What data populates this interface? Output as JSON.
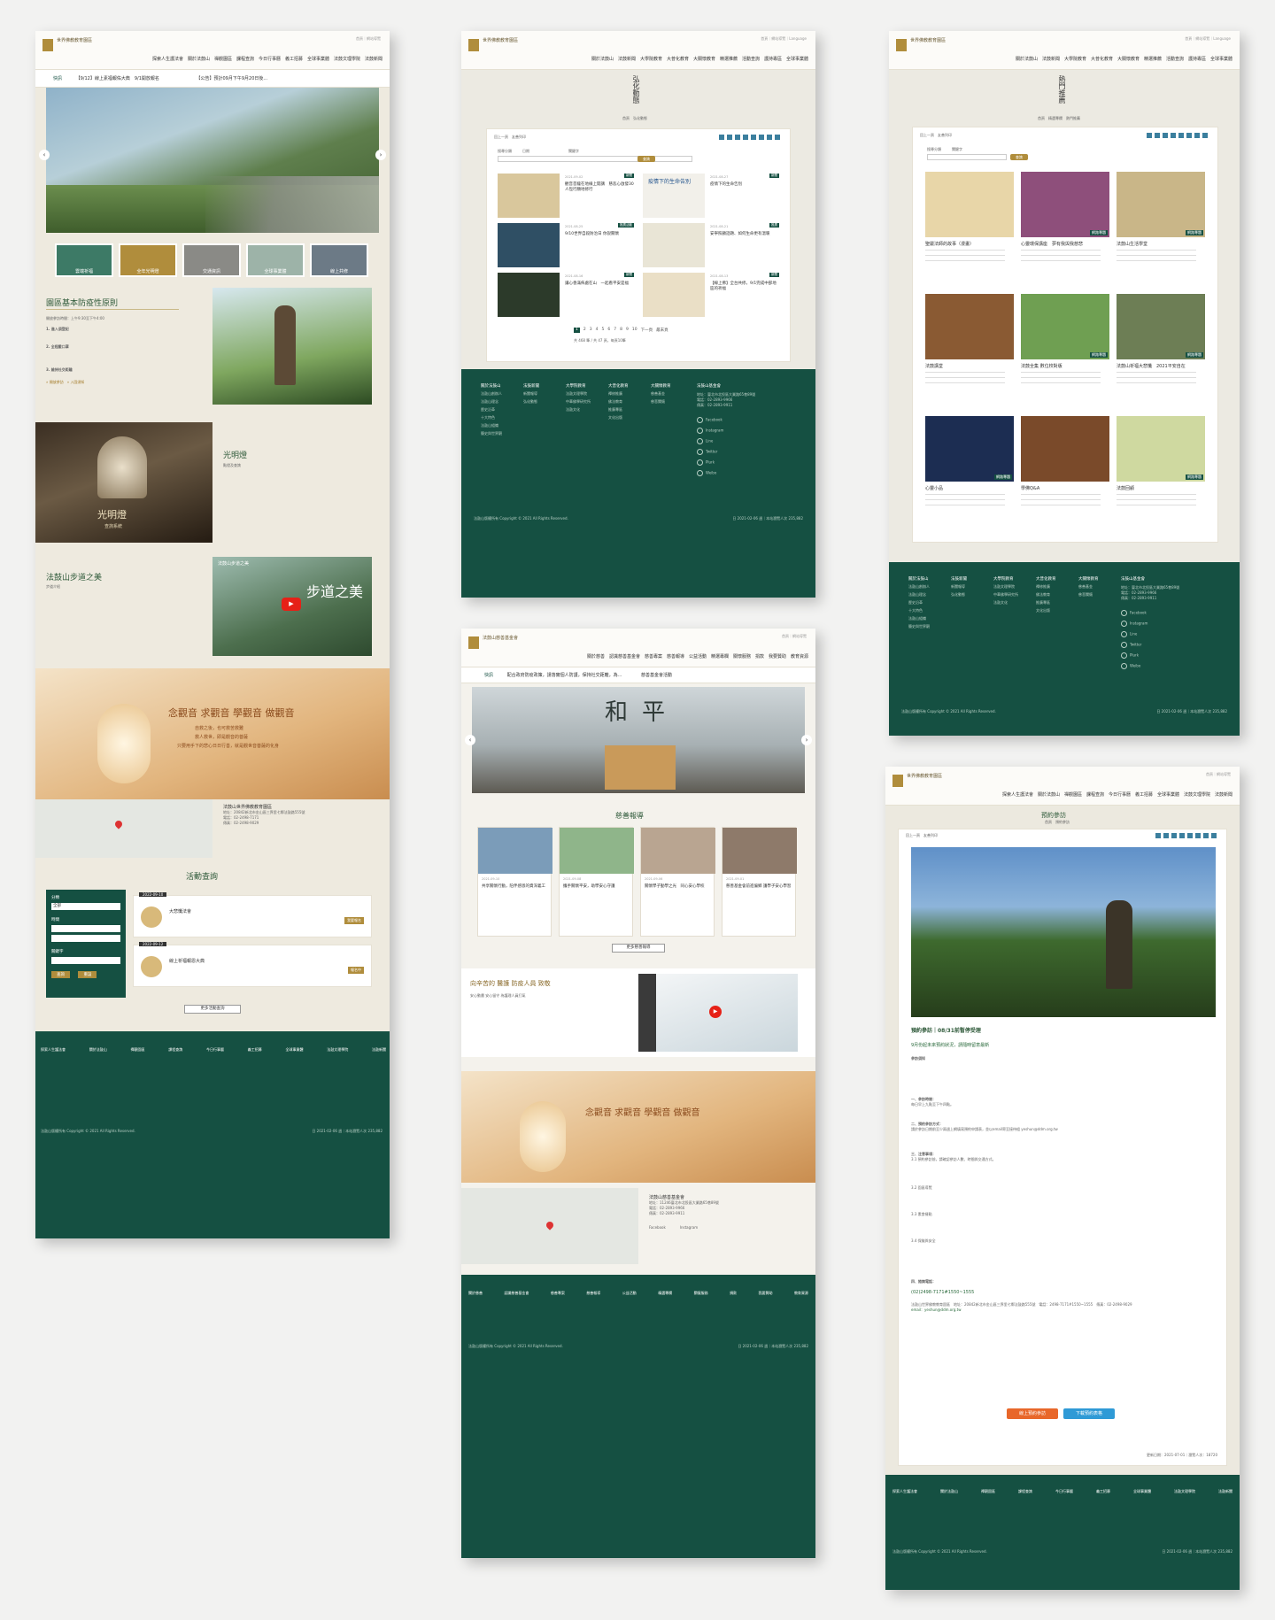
{
  "brand": {
    "name": "法鼓山",
    "org": "世界佛教教育園區",
    "accent": "#155042",
    "gold": "#b08d3c"
  },
  "nav": {
    "p1": "探索人生護法會　關於法鼓山　禪觀園區　課程查詢　今日行事曆　義工招募　全球事業體　法鼓文理學院　法鼓新聞",
    "p2": "關於法鼓山　法鼓新聞　大學院教育　大普化教育　大關懷教育　精選推薦　活動查詢　護持專區　全球事業體",
    "p4": "關於慈善　認識慈善基金會　慈善專案　慈善報導　公益活動　精選專欄　關懷服務　捐款　我要贊助　教育資源"
  },
  "util": {
    "login": "首頁",
    "sitemap": "網站導覽",
    "language": "Language"
  },
  "p1": {
    "ticker_label": "快訊",
    "ticker_1": "【9/12】線上素福報佑大典　9/1開放報名",
    "ticker_2": "【公告】預計09月下午9月20日後...",
    "quick_links": [
      "雲端祈福",
      "全年光明燈",
      "交通資訊",
      "全球事業體",
      "線上共修"
    ],
    "epidemic_title": "園區基本防疫性原則",
    "epidemic_hours": "開放參訪時間：上午9:30至下午4:00",
    "epidemic_1": "1. 進入須登記",
    "epidemic_2": "2. 全程戴口罩",
    "epidemic_3": "3. 維持社交距離",
    "epidemic_link1": "» 開放參訪",
    "epidemic_link2": "» 入園須知",
    "lamp_title": "光明燈",
    "lamp_sub": "點燈及查詢",
    "lamp_img_text": "光明燈",
    "lamp_img_sub": "查詢系統",
    "trail_title": "法鼓山步道之美",
    "trail_sub": "步道介紹",
    "video_title": "法鼓山步道之美",
    "video_word": "步道之美",
    "banner_title": "念觀音 求觀音 學觀音 做觀音",
    "banner_sub1": "自救之後，也可救苦救難",
    "banner_sub2": "救人救世，即是觀音的菩薩",
    "banner_sub3": "只要用手下的悲心日日行善，就是觀世音菩薩的化身",
    "map_name": "法鼓山世界佛教教育園區",
    "addr": "地址：20842新北市金山區三界里七鄰法鼓路555號",
    "tel": "電話：02-2498-7171",
    "fax": "傳真：02-2498-9029",
    "activity_title": "活動查詢",
    "filter_cat": "分類",
    "filter_all": "全部",
    "filter_date": "時間",
    "filter_key": "關鍵字",
    "filter_search": "查詢",
    "filter_reset": "重設",
    "ev1_date": "2022-09-10",
    "ev1_title": "大悲懺法會",
    "ev1_btn": "我要報名",
    "ev2_date": "2022-09-12",
    "ev2_title": "線上祈福報恩大典",
    "ev2_btn": "報名中",
    "more_events": "更多活動查詢",
    "footer_cols": [
      "探索人生護法會",
      "關於法鼓山",
      "禪觀園區",
      "課程查詢",
      "今日行事曆",
      "義工招募",
      "全球事業體",
      "法鼓文理學院",
      "法鼓新聞"
    ],
    "copyright": "法鼓山版權所有 Copyright © 2021 All Rights Reserved.",
    "updated": "日 2021-02-06 週｜本站瀏覽人次 235,882"
  },
  "p2": {
    "title": "弘化動態",
    "crumb": "首頁　弘化動態",
    "back": "回上一頁",
    "print": "友善列印",
    "filter_type": "搜尋分類",
    "filter_date": "日期",
    "filter_key": "關鍵字",
    "btn_search": "查詢",
    "items": [
      {
        "date": "2021-09-02",
        "tag": "新聞",
        "title": "觀音菩薩在地線上開講　慈悲心啟發30人恆行願地修行"
      },
      {
        "date": "2021-08-27",
        "tag": "新聞",
        "title": "疫情下的生命告別"
      },
      {
        "date": "2021-08-25",
        "tag": "推廣活動",
        "title": "9/10世界自殺防治日 你說關懷"
      },
      {
        "date": "2021-08-21",
        "tag": "推廣",
        "title": "安寧照顧話題、如何生命更有溫暖"
      },
      {
        "date": "2021-08-16",
        "tag": "新聞",
        "title": "讓心香滿佈處在山　一起看平安是福"
      },
      {
        "date": "2021-08-13",
        "tag": "新聞",
        "title": "【線上佛】全台共修，9/1完成中部地區的祈福"
      }
    ],
    "img_caption": "疫情下的生命告別",
    "pager": [
      "1",
      "2",
      "3",
      "4",
      "5",
      "6",
      "7",
      "8",
      "9",
      "10",
      "下一頁",
      "最末頁"
    ],
    "total": "共 468 筆 / 共 47 頁，每頁10筆",
    "footer": {
      "cols": [
        {
          "title": "關於法鼓山",
          "items": [
            "法鼓山創辦人",
            "法鼓山理念",
            "歷史沿革",
            "十大特色",
            "法鼓山組織",
            "簡史與世界觀"
          ]
        },
        {
          "title": "法鼓新聞",
          "items": [
            "新聞報導",
            "弘化動態"
          ]
        },
        {
          "title": "大學院教育",
          "items": [
            "法鼓文理學院",
            "中華佛學研究所",
            "法鼓文化"
          ]
        },
        {
          "title": "大普化教育",
          "items": [
            "禪修推廣",
            "佛法教育",
            "推廣專區",
            "文化出版"
          ]
        },
        {
          "title": "大關懷教育",
          "items": [
            "慈善基金",
            "慈悲關懷"
          ]
        }
      ],
      "contact_title": "法鼓山基金會",
      "addr": "地址：臺北市北投區大業路65巷89號",
      "tel": "電話：02-2893-9966",
      "fax": "傳真：02-2893-9911",
      "socials": [
        "Facebook",
        "Instagram",
        "Line",
        "Twitter",
        "Plurk",
        "Weibo"
      ],
      "copyright": "法鼓山版權所有 Copyright © 2021 All Rights Reserved.",
      "updated": "日 2021-02-06 週｜本站瀏覽人次 235,882"
    }
  },
  "p3": {
    "title": "熱門推薦",
    "crumb": "首頁　精選專欄　熱門推薦",
    "back": "回上一頁",
    "print": "友善列印",
    "filter_type": "搜尋分類",
    "filter_key": "關鍵字",
    "btn_search": "查詢",
    "items": [
      {
        "title": "聖嚴法師的故事（漫畫）",
        "tag": ""
      },
      {
        "title": "心靈環保講座　夢有我與我慈悲",
        "tag": "網路專題"
      },
      {
        "title": "法鼓山生活學堂",
        "tag": "網路專題"
      },
      {
        "title": "法鼓講堂",
        "tag": ""
      },
      {
        "title": "法鼓全集 數位校對版",
        "tag": "網路專題"
      },
      {
        "title": "法鼓山祈福大悲懺　2021平安自在",
        "tag": "網路專題"
      },
      {
        "title": "心靈小品",
        "tag": "網路專題"
      },
      {
        "title": "學佛Q&A",
        "tag": ""
      },
      {
        "title": "法鼓回顧",
        "tag": "網路專題"
      }
    ]
  },
  "p4": {
    "ticker_label": "快訊",
    "ticker_1": "配合政府防疫政策，請落實個人防護，保持社交距離，為...",
    "ticker_2": "慈善基金會活動",
    "hero_sign": "和平",
    "report_title": "慈善報導",
    "reports": [
      {
        "date": "2021-09-10",
        "title": "共享關懷行動，陪伴感恩的資深義工"
      },
      {
        "date": "2021-09-08",
        "title": "攜手關懷平安，助學安心守護"
      },
      {
        "date": "2021-09-06",
        "title": "關懷學子勤學之光　同心安心學校"
      },
      {
        "date": "2021-09-01",
        "title": "慈善基金會前進偏鄉 護學子安心學習"
      }
    ],
    "more_reports": "更多慈善報導",
    "care_title": "向辛苦的 醫護 防疫人員 致敬",
    "care_sub": "安心動畫 安心留守 為護理人員打氣",
    "banner_title": "念觀音 求觀音 學觀音 做觀音",
    "org": "法鼓山慈善基金會",
    "addr": "地址：11246臺北市北投區大業路65巷89號",
    "tel": "電話：02-2893-9966",
    "fax": "傳真：02-2893-9911",
    "socials": [
      "Facebook",
      "Instagram"
    ],
    "copyright": "法鼓山版權所有 Copyright © 2021 All Rights Reserved.",
    "updated": "日 2021-02-06 週｜本站瀏覽人次 235,882"
  },
  "p5": {
    "title": "預約參訪",
    "crumb": "首頁　預約參訪",
    "back": "回上一頁",
    "print": "友善列印",
    "notice_title": "預約參訪｜08/31前暫停受理",
    "notice_sub": "9月份起未來預約狀況，請隨時留意最新",
    "p1": "參訪須知",
    "p2": "一、參訪時間：",
    "p3": "每日早上九點至下午四點。",
    "p4": "二、預約參訪方式：",
    "p5": "請於參訪日期前至少兩週上網填寫預約申請表，並以email寄至接待組 yeshun@ddm.org.tw",
    "p6": "三、注意事項：",
    "p7": "3.1 預約參訪前，請確認參訪人數、時間與交通方式。",
    "p8": "3.2 園區導覽",
    "p9": "3.3 素食餐點",
    "p10": "3.4 保險與安全",
    "p11": "四、諮詢電話：",
    "phone": "(02)2498-7171#1550~1555",
    "contact_lines": "法鼓山世界佛教教育園區　地址：20842新北市金山區三界里七鄰法鼓路555號　電話：2498-7171#1550~1555　傳真：02-2498-9029",
    "email": "email：yeshun@ddm.org.tw",
    "btn_online": "線上預約參訪",
    "btn_download": "下載預約表格",
    "updated_line": "更新日期：2021-07-01｜瀏覽人次：18720",
    "footer_cols": [
      "探索人生護法會",
      "關於法鼓山",
      "禪觀園區",
      "課程查詢",
      "今日行事曆",
      "義工招募",
      "全球事業體",
      "法鼓文理學院",
      "法鼓新聞"
    ],
    "copyright": "法鼓山版權所有 Copyright © 2021 All Rights Reserved.",
    "updated": "日 2021-02-06 週｜本站瀏覽人次 235,882"
  }
}
